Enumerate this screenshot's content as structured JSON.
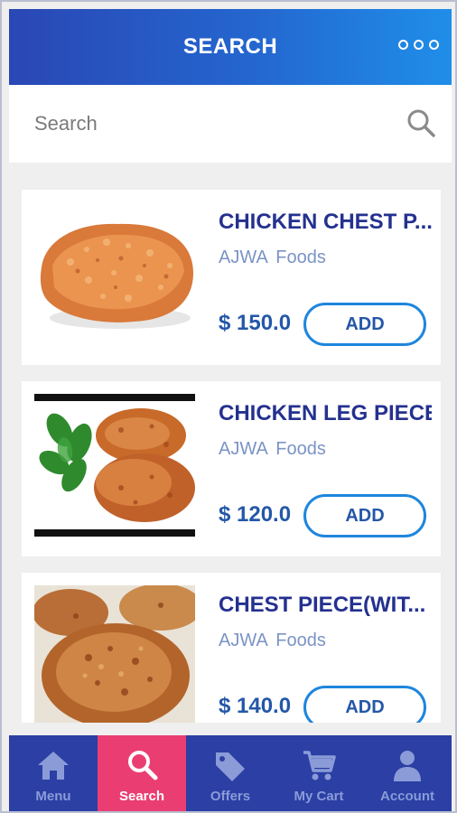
{
  "header": {
    "title": "SEARCH"
  },
  "search": {
    "placeholder": "Search"
  },
  "items": [
    {
      "title": "CHICKEN CHEST P...",
      "vendor": "AJWA Foods",
      "price": "$ 150.0",
      "add_label": "ADD"
    },
    {
      "title": "CHICKEN LEG PIECE",
      "vendor": "AJWA Foods",
      "price": "$ 120.0",
      "add_label": "ADD"
    },
    {
      "title": "CHEST PIECE(WIT...",
      "vendor": "AJWA Foods",
      "price": "$ 140.0",
      "add_label": "ADD"
    }
  ],
  "nav": [
    {
      "label": "Menu",
      "icon": "home-icon",
      "active": false
    },
    {
      "label": "Search",
      "icon": "search-icon",
      "active": true
    },
    {
      "label": "Offers",
      "icon": "tag-icon",
      "active": false
    },
    {
      "label": "My Cart",
      "icon": "cart-icon",
      "active": false
    },
    {
      "label": "Account",
      "icon": "person-icon",
      "active": false
    }
  ],
  "colors": {
    "header_gradient_start": "#2a47b5",
    "header_gradient_end": "#1f8ee9",
    "title_text": "#24318f",
    "price_text": "#2457a8",
    "add_border": "#1e86dd",
    "nav_bg": "#2b3fa4",
    "nav_active": "#ea3e73"
  }
}
